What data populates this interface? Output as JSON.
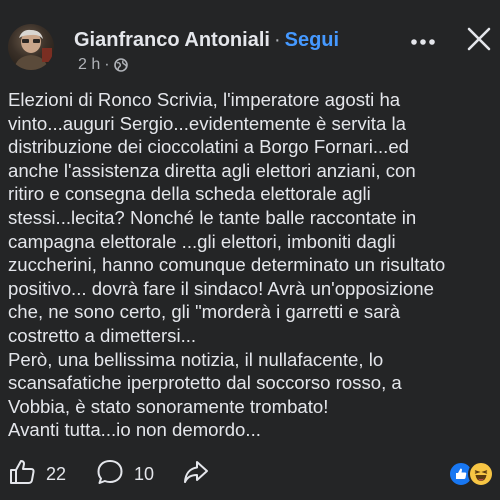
{
  "post": {
    "author": "Gianfranco Antoniali",
    "separator": "·",
    "follow_label": "Segui",
    "time": "2 h",
    "separator_small": "·",
    "visibility_icon": "globe-icon",
    "more_icon": "more-horizontal-icon",
    "close_icon": "close-icon",
    "text": "Elezioni di Ronco Scrivia, l'imperatore agosti ha\nvinto...auguri Sergio...evidentemente è servita la\ndistribuzione dei cioccolatini a Borgo Fornari...ed\nanche l'assistenza diretta agli elettori anziani, con\nritiro e consegna della scheda elettorale agli\nstessi...lecita? Nonché le tante balle raccontate in\ncampagna elettorale ...gli elettori, imboniti dagli\nzuccherini, hanno comunque determinato un risultato\npositivo... dovrà fare il sindaco! Avrà un'opposizione\nche, ne sono certo, gli \"morderà i garretti e sarà\ncostretto a dimettersi...\nPerò, una bellissima notizia, il nullafacente, lo\nscansafatiche iperprotetto dal soccorso rosso, a\nVobbia, è stato sonoramente trombato!\nAvanti tutta...io non demordo..."
  },
  "footer": {
    "like_icon": "thumbs-up-icon",
    "like_count": "22",
    "comment_icon": "comment-icon",
    "comment_count": "10",
    "share_icon": "share-icon",
    "reactions": [
      "like",
      "haha"
    ]
  },
  "colors": {
    "background": "#242526",
    "text": "#e4e6eb",
    "secondary_text": "#b0b3b8",
    "link_blue": "#4599ff",
    "reaction_like": "#1877f2",
    "reaction_haha": "#f7c544"
  }
}
